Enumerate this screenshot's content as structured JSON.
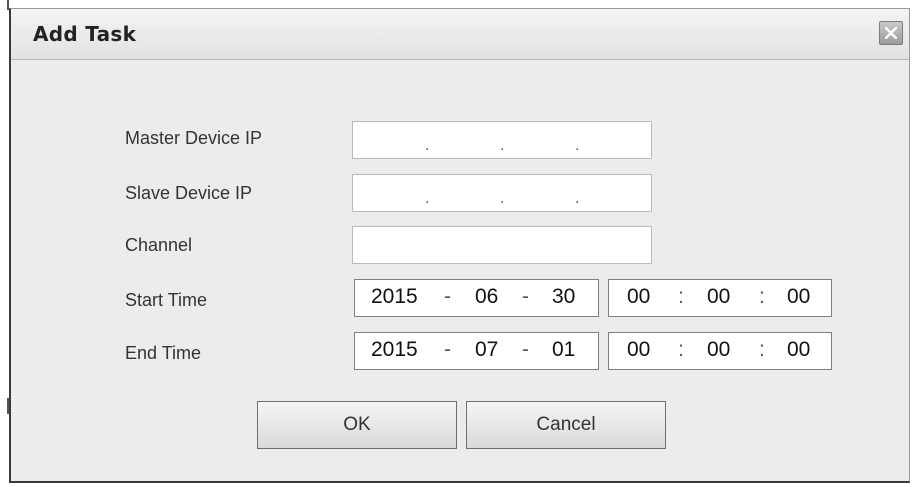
{
  "dialog": {
    "title": "Add Task",
    "close_icon": "close-icon"
  },
  "form": {
    "master_ip": {
      "label": "Master Device IP",
      "value": [
        "",
        "",
        "",
        ""
      ]
    },
    "slave_ip": {
      "label": "Slave Device IP",
      "value": [
        "",
        "",
        "",
        ""
      ]
    },
    "channel": {
      "label": "Channel",
      "value": ""
    },
    "start_time": {
      "label": "Start Time",
      "year": "2015",
      "month": "06",
      "day": "30",
      "hour": "00",
      "minute": "00",
      "second": "00"
    },
    "end_time": {
      "label": "End Time",
      "year": "2015",
      "month": "07",
      "day": "01",
      "hour": "00",
      "minute": "00",
      "second": "00"
    },
    "separators": {
      "date": "-",
      "time": ":",
      "ip": "."
    }
  },
  "buttons": {
    "ok": "OK",
    "cancel": "Cancel"
  }
}
